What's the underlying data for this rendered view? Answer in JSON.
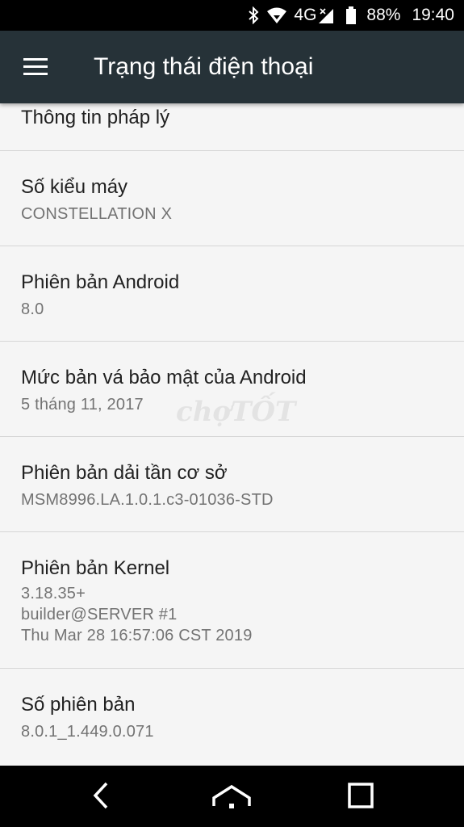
{
  "status_bar": {
    "network": "4G",
    "battery": "88%",
    "time": "19:40"
  },
  "toolbar": {
    "title": "Trạng thái điện thoại"
  },
  "items": [
    {
      "title": "Thông tin pháp lý",
      "value": ""
    },
    {
      "title": "Số kiểu máy",
      "value": "CONSTELLATION X"
    },
    {
      "title": "Phiên bản Android",
      "value": "8.0"
    },
    {
      "title": "Mức bản vá bảo mật của Android",
      "value": "5 tháng 11, 2017"
    },
    {
      "title": "Phiên bản dải tần cơ sở",
      "value": "MSM8996.LA.1.0.1.c3-01036-STD"
    },
    {
      "title": "Phiên bản Kernel",
      "value": "3.18.35+\nbuilder@SERVER #1\nThu Mar 28 16:57:06 CST 2019"
    },
    {
      "title": "Số phiên bản",
      "value": "8.0.1_1.449.0.071"
    }
  ],
  "watermark": "chợTỐT",
  "colors": {
    "toolbar": "#263238",
    "background": "#f5f5f5",
    "title_text": "#212121",
    "value_text": "#737373"
  },
  "icons": [
    "bluetooth-icon",
    "wifi-icon",
    "cellular-signal-icon",
    "battery-icon",
    "menu-icon",
    "back-icon",
    "home-icon",
    "recents-icon"
  ]
}
